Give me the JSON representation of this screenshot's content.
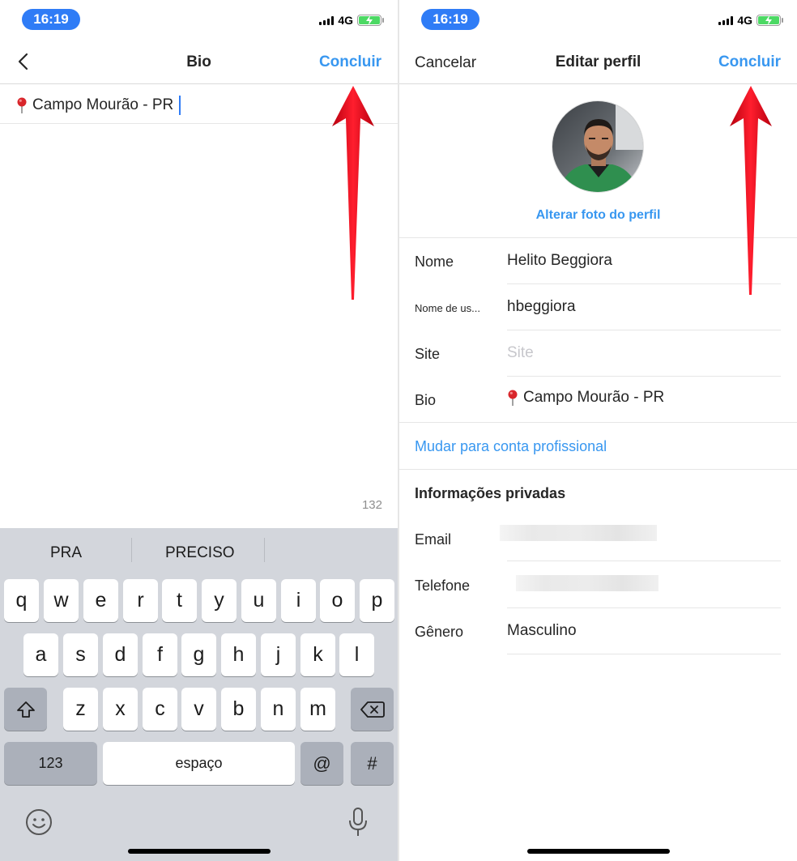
{
  "status": {
    "time": "16:19",
    "network": "4G"
  },
  "bio_screen": {
    "title": "Bio",
    "done_label": "Concluir",
    "bio_text": "Campo Mourão - PR",
    "char_count": "132",
    "keyboard": {
      "suggestions": [
        "PRA",
        "PRECISO"
      ],
      "row1": [
        "q",
        "w",
        "e",
        "r",
        "t",
        "y",
        "u",
        "i",
        "o",
        "p"
      ],
      "row2": [
        "a",
        "s",
        "d",
        "f",
        "g",
        "h",
        "j",
        "k",
        "l"
      ],
      "row3": [
        "z",
        "x",
        "c",
        "v",
        "b",
        "n",
        "m"
      ],
      "numbers_label": "123",
      "space_label": "espaço",
      "at_label": "@",
      "hash_label": "#"
    }
  },
  "edit_profile": {
    "cancel_label": "Cancelar",
    "title": "Editar perfil",
    "done_label": "Concluir",
    "change_photo_label": "Alterar foto do perfil",
    "fields": {
      "name_label": "Nome",
      "name_value": "Helito Beggiora",
      "username_label": "Nome de us...",
      "username_value": "hbeggiora",
      "site_label": "Site",
      "site_placeholder": "Site",
      "bio_label": "Bio",
      "bio_value": "Campo Mourão - PR"
    },
    "professional_link": "Mudar para conta profissional",
    "private_section_title": "Informações privadas",
    "private_fields": {
      "email_label": "Email",
      "phone_label": "Telefone",
      "gender_label": "Gênero",
      "gender_value": "Masculino"
    }
  },
  "colors": {
    "accent": "#3897f0",
    "arrow": "#e3061c",
    "time_pill": "#2f7cf6"
  }
}
